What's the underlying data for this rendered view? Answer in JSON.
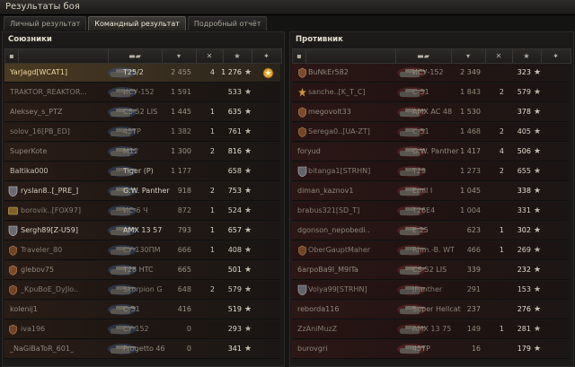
{
  "window": {
    "title": "Результаты боя"
  },
  "tabs": [
    "Личный результат",
    "Командный результат",
    "Подробный отчёт"
  ],
  "active_tab": 1,
  "allies": {
    "title": "Союзники",
    "rows": [
      {
        "player": "YarJagd[WCAT1]",
        "tank": "T25/2",
        "damage": "2 455",
        "kills": "4",
        "xp": "1 276",
        "medal": true,
        "state": "player",
        "badge": ""
      },
      {
        "player": "TRAKTOR_REAKTOR...",
        "tank": "ИСУ-152",
        "damage": "1 591",
        "kills": "",
        "xp": "533",
        "state": "dead",
        "badge": ""
      },
      {
        "player": "Aleksey_s_PTZ",
        "tank": "CS-52 LIS",
        "damage": "1 445",
        "kills": "1",
        "xp": "635",
        "state": "dead",
        "badge": ""
      },
      {
        "player": "solov_16[PB_ED]",
        "tank": "45TP",
        "damage": "1 382",
        "kills": "1",
        "xp": "761",
        "state": "dead",
        "badge": ""
      },
      {
        "player": "SuperKote",
        "tank": "M12",
        "damage": "1 300",
        "kills": "2",
        "xp": "816",
        "state": "dead",
        "badge": ""
      },
      {
        "player": "Baltika000",
        "tank": "Tiger (P)",
        "damage": "1 177",
        "kills": "",
        "xp": "658",
        "state": "alive",
        "badge": ""
      },
      {
        "player": "ryslan8..[_PRE_]",
        "tank": "G.W. Panther",
        "damage": "918",
        "kills": "2",
        "xp": "753",
        "state": "alive",
        "badge": "shield"
      },
      {
        "player": "borovik..[FOX97]",
        "tank": "ИС-6 Ч",
        "damage": "872",
        "kills": "1",
        "xp": "524",
        "state": "dead",
        "badge": "logo"
      },
      {
        "player": "Sergh89[Z-U59]",
        "tank": "AMX 13 57",
        "damage": "793",
        "kills": "1",
        "xp": "657",
        "state": "alive",
        "badge": "shield"
      },
      {
        "player": "Traveler_80",
        "tank": "СУ-130ПМ",
        "damage": "666",
        "kills": "1",
        "xp": "408",
        "state": "dead",
        "badge": "emblem"
      },
      {
        "player": "glebov75",
        "tank": "T28 HTC",
        "damage": "665",
        "kills": "",
        "xp": "501",
        "state": "dead",
        "badge": "emblem"
      },
      {
        "player": "_KpuBoE_DyJlo..",
        "tank": "Skorpion G",
        "damage": "648",
        "kills": "2",
        "xp": "579",
        "state": "dead",
        "badge": "emblem"
      },
      {
        "player": "kolenij1",
        "tank": "C-51",
        "damage": "416",
        "kills": "",
        "xp": "519",
        "state": "dead",
        "badge": ""
      },
      {
        "player": "iva196",
        "tank": "СУ-152",
        "damage": "0",
        "kills": "",
        "xp": "293",
        "state": "dead",
        "badge": "emblem"
      },
      {
        "player": "_NaGiBaToR_601_",
        "tank": "Progetto 46",
        "damage": "0",
        "kills": "",
        "xp": "341",
        "state": "dead",
        "badge": ""
      }
    ]
  },
  "enemies": {
    "title": "Противник",
    "rows": [
      {
        "player": "BuNkEr582",
        "tank": "ИСУ-152",
        "damage": "2 349",
        "kills": "",
        "xp": "323",
        "state": "dead",
        "badge": "emblem"
      },
      {
        "player": "sanche..[K_T_C]",
        "tank": "C-51",
        "damage": "1 843",
        "kills": "2",
        "xp": "579",
        "state": "dead",
        "badge": "star"
      },
      {
        "player": "megovolt33",
        "tank": "AMX AC 48",
        "damage": "1 530",
        "kills": "",
        "xp": "378",
        "state": "dead",
        "badge": "emblem"
      },
      {
        "player": "Serega0..[UA-ZT]",
        "tank": "C-51",
        "damage": "1 468",
        "kills": "2",
        "xp": "405",
        "state": "dead",
        "badge": "emblem"
      },
      {
        "player": "foryud",
        "tank": "G.W. Panther",
        "damage": "1 417",
        "kills": "4",
        "xp": "506",
        "state": "dead",
        "badge": ""
      },
      {
        "player": "bitanga1[STRHN]",
        "tank": "T29",
        "damage": "1 273",
        "kills": "2",
        "xp": "655",
        "state": "dead",
        "badge": "shield"
      },
      {
        "player": "diman_kaznov1",
        "tank": "Emil I",
        "damage": "1 045",
        "kills": "",
        "xp": "338",
        "state": "dead",
        "badge": ""
      },
      {
        "player": "brabus321[SD_T]",
        "tank": "T26E4",
        "damage": "1 004",
        "kills": "",
        "xp": "331",
        "state": "dead",
        "badge": ""
      },
      {
        "player": "dgonson_nepobedi..",
        "tank": "E 25",
        "damage": "623",
        "kills": "1",
        "xp": "302",
        "state": "dead",
        "badge": ""
      },
      {
        "player": "OberGauptMaher",
        "tank": "Rhm.-B. WT",
        "damage": "466",
        "kills": "1",
        "xp": "269",
        "state": "dead",
        "badge": "emblem"
      },
      {
        "player": "6arpoBa9I_M9ITa",
        "tank": "CS-52 LIS",
        "damage": "339",
        "kills": "",
        "xp": "232",
        "state": "dead",
        "badge": ""
      },
      {
        "player": "Volya99[STRHN]",
        "tank": "JPanther",
        "damage": "291",
        "kills": "",
        "xp": "153",
        "state": "dead",
        "badge": "shield"
      },
      {
        "player": "reborda116",
        "tank": "Super Hellcat",
        "damage": "237",
        "kills": "",
        "xp": "276",
        "state": "dead",
        "badge": ""
      },
      {
        "player": "ZzAniMuzZ",
        "tank": "AMX 13 75",
        "damage": "149",
        "kills": "1",
        "xp": "281",
        "state": "dead",
        "badge": ""
      },
      {
        "player": "burovgri",
        "tank": "45TP",
        "damage": "16",
        "kills": "",
        "xp": "179",
        "state": "dead",
        "badge": ""
      }
    ]
  },
  "colors": {
    "ally_tank": "#3a4f73",
    "enemy_tank": "#6b2a2a",
    "player_row": "#4a3a22",
    "medal": "#e0a030"
  },
  "icons": {
    "header_columns": [
      "squad-icon",
      "tank-icon",
      "sort-arrow-icon",
      "kills-icon",
      "star-icon",
      "medal-icon"
    ]
  }
}
